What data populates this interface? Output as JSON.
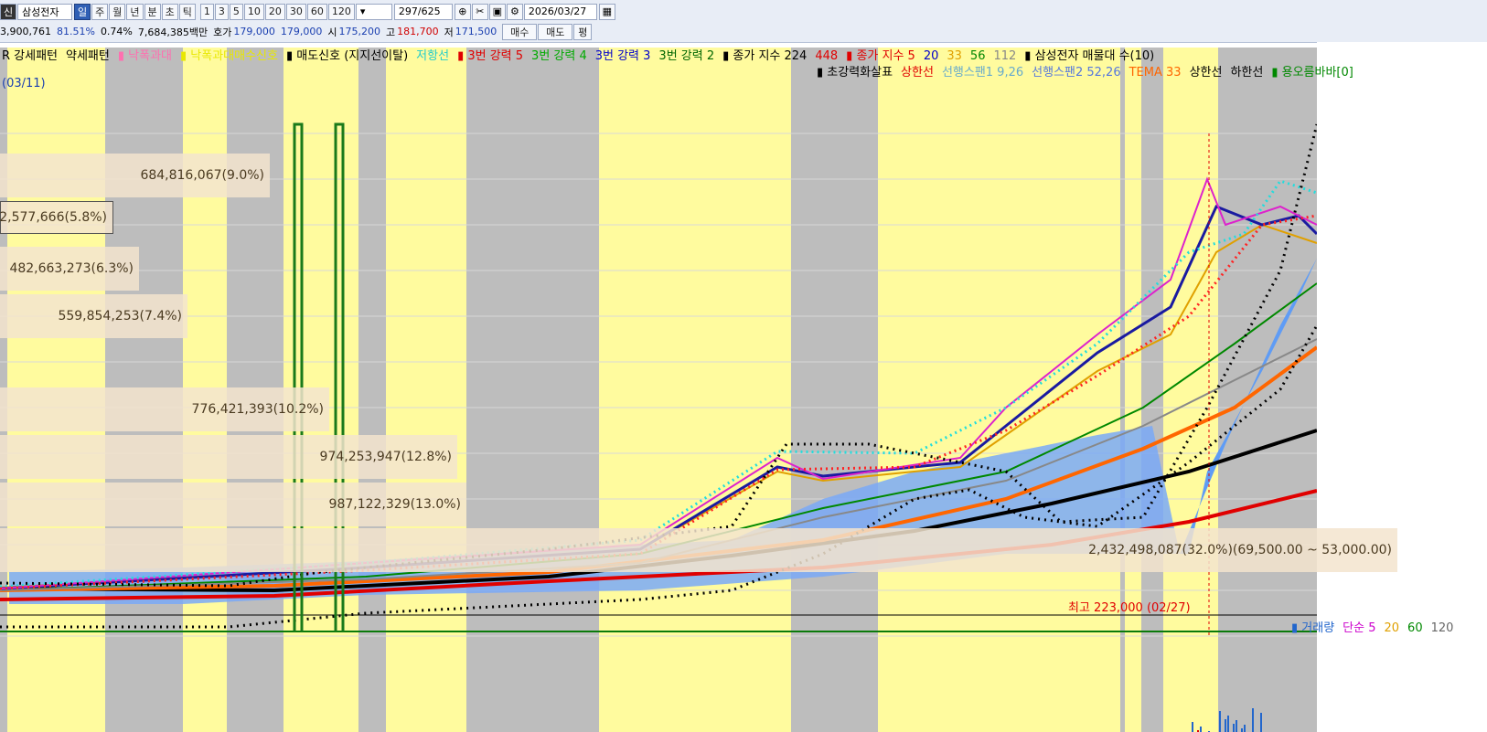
{
  "toolbar": {
    "stock_badge": "신",
    "stock_name": "삼성전자",
    "periods": [
      "일",
      "주",
      "월",
      "년",
      "분",
      "초",
      "틱"
    ],
    "active_period": "일",
    "intervals": [
      "1",
      "3",
      "5",
      "10",
      "20",
      "30",
      "60",
      "120"
    ],
    "count_display": "297",
    "count_total": "/625",
    "date": "2026/03/27",
    "icons": [
      "crosshair-icon",
      "split-icon",
      "save-icon",
      "gear-icon",
      "calendar-icon"
    ]
  },
  "quote": {
    "volume": "3,900,761",
    "rate1": "81.51%",
    "rate2": "0.74%",
    "amount": "7,684,385백만",
    "hoga_label": "호가",
    "hoga1": "179,000",
    "hoga2": "179,000",
    "open_label": "시",
    "open": "175,200",
    "high_label": "고",
    "high": "181,700",
    "low_label": "저",
    "low": "171,500",
    "buy_label": "매수",
    "sell_label": "매도",
    "flat_label": "평"
  },
  "legend_row1": [
    {
      "text": "R 강세패턴",
      "color": "#000000"
    },
    {
      "text": "약세패턴",
      "color": "#000000"
    },
    {
      "text": "▮ 낙폭과대",
      "color": "#ff6fb0"
    },
    {
      "text": "▮ 낙폭과대매수신호",
      "color": "#e8e800"
    },
    {
      "text": "▮ 매도신호 (지지선이탈)",
      "color": "#000000"
    },
    {
      "text": "저항선",
      "color": "#22cccc"
    },
    {
      "text": "▮ 3번 강력 5",
      "color": "#e00000"
    },
    {
      "text": "3번 강력 4",
      "color": "#00aa00"
    },
    {
      "text": "3번 강력 3",
      "color": "#0000cc"
    },
    {
      "text": "3번 강력 2",
      "color": "#006600"
    },
    {
      "text": "▮ 종가 지수 224",
      "color": "#000000"
    },
    {
      "text": "448",
      "color": "#e00000"
    },
    {
      "text": "▮ 종가 지수 5",
      "color": "#e00000"
    },
    {
      "text": "20",
      "color": "#0000cc"
    },
    {
      "text": "33",
      "color": "#e0a000"
    },
    {
      "text": "56",
      "color": "#008800"
    },
    {
      "text": "112",
      "color": "#888888"
    },
    {
      "text": "▮ 삼성전자 매물대 수(10)",
      "color": "#000000"
    }
  ],
  "legend_row2": [
    {
      "text": "▮ 초강력화살표",
      "color": "#000000"
    },
    {
      "text": "상한선",
      "color": "#e00000"
    },
    {
      "text": "선행스팬1 9,26",
      "color": "#66aacc"
    },
    {
      "text": "선행스팬2 52,26",
      "color": "#5577dd"
    },
    {
      "text": "TEMA 33",
      "color": "#ff6600"
    },
    {
      "text": "상한선",
      "color": "#000000"
    },
    {
      "text": "하한선",
      "color": "#000000"
    },
    {
      "text": "▮ 용오름바바[0]",
      "color": "#008800"
    }
  ],
  "date_marker": "(03/11)",
  "volume_profile": [
    {
      "label": "684,816,067(9.0%)"
    },
    {
      "label": "2,577,666(5.8%)"
    },
    {
      "label": "482,663,273(6.3%)"
    },
    {
      "label": "559,854,253(7.4%)"
    },
    {
      "label": "776,421,393(10.2%)"
    },
    {
      "label": "974,253,947(12.8%)"
    },
    {
      "label": "987,122,329(13.0%)"
    },
    {
      "label": "2,432,498,087(32.0%)(69,500.00 ~ 53,000.00)"
    }
  ],
  "max_price_label": "최고 223,000 (02/27)",
  "volume_legend": [
    {
      "text": "▮ 거래량",
      "color": "#2266cc"
    },
    {
      "text": "단순 5",
      "color": "#cc00cc"
    },
    {
      "text": "20",
      "color": "#e0a000"
    },
    {
      "text": "60",
      "color": "#008800"
    },
    {
      "text": "120",
      "color": "#666666"
    }
  ]
}
